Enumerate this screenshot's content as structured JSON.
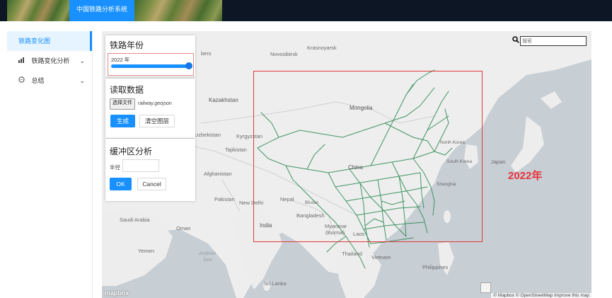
{
  "header": {
    "title": "中国铁路分析系统"
  },
  "sidebar": {
    "items": [
      {
        "label": "铁路变化图",
        "icon": "",
        "active": true
      },
      {
        "label": "铁路变化分析",
        "icon": "bar-chart-icon",
        "has_chevron": true
      },
      {
        "label": "总结",
        "icon": "message-icon",
        "has_chevron": true
      }
    ]
  },
  "year_panel": {
    "title": "铁路年份",
    "slider_label": "2022 年",
    "slider_fraction": 1.0
  },
  "data_panel": {
    "title": "读取数据",
    "file_button": "选择文件",
    "file_name": "railway.geojson",
    "generate_button": "生成",
    "clear_button": "清空图层"
  },
  "buffer_panel": {
    "title": "缓冲区分析",
    "radius_label": "半径",
    "ok_button": "OK",
    "cancel_button": "Cancel"
  },
  "search": {
    "placeholder": "搜索"
  },
  "map": {
    "year_overlay": "2022年",
    "logo": "mapbox",
    "attribution": "© Mapbox © OpenStreetMap Improve this map",
    "labels": {
      "siberia": "bers",
      "novosibirsk": "Novosibirsk",
      "krasnoyarsk": "Krasnoyarsk",
      "kazakhstan": "Kazakhstan",
      "mongolia": "Mongolia",
      "uzbekistan": "Uzbekistan",
      "kyrgyzstan": "Kyrgyzstan",
      "tajikistan": "Tajikistan",
      "afghanistan": "Afghanistan",
      "pakistan": "Pakistan",
      "new_delhi": "New Delhi",
      "nepal": "Nepal",
      "bhutan": "Bhutan",
      "bangladesh": "Bangladesh",
      "india": "India",
      "myanmar": "Myanmar",
      "burma": "(Burma)",
      "laos": "Laos",
      "thailand": "Thailand",
      "vietnam": "Vietnam",
      "philippines": "Philippines",
      "china": "China",
      "north_korea": "North Korea",
      "south_korea": "South Korea",
      "japan": "Japan",
      "saudi": "Saudi Arabia",
      "oman": "Oman",
      "yemen": "Yemen",
      "arabian_sea": "Arabian",
      "sea": "Sea",
      "sri_lanka": "Sri Lanka",
      "shanghai": "Shanghai"
    }
  },
  "colors": {
    "accent": "#1890ff",
    "rail": "#2e8b57",
    "highlight": "#e23a3a"
  }
}
